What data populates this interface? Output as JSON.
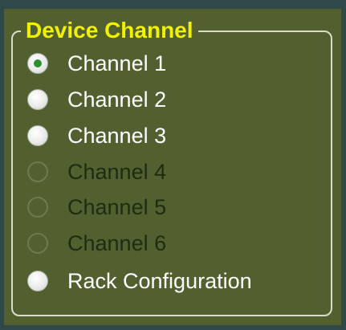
{
  "group": {
    "title": "Device Channel"
  },
  "options": [
    {
      "label": "Channel 1",
      "selected": true,
      "enabled": true
    },
    {
      "label": "Channel 2",
      "selected": false,
      "enabled": true
    },
    {
      "label": "Channel 3",
      "selected": false,
      "enabled": true
    },
    {
      "label": "Channel 4",
      "selected": false,
      "enabled": false
    },
    {
      "label": "Channel 5",
      "selected": false,
      "enabled": false
    },
    {
      "label": "Channel 6",
      "selected": false,
      "enabled": false
    },
    {
      "label": "Rack Configuration",
      "selected": false,
      "enabled": true
    }
  ],
  "colors": {
    "background": "#314848",
    "panel": "#526030",
    "title": "#f2f200",
    "label_enabled": "#ffffff",
    "label_disabled": "#1f2b12",
    "selected_dot": "#2f8f2f"
  }
}
